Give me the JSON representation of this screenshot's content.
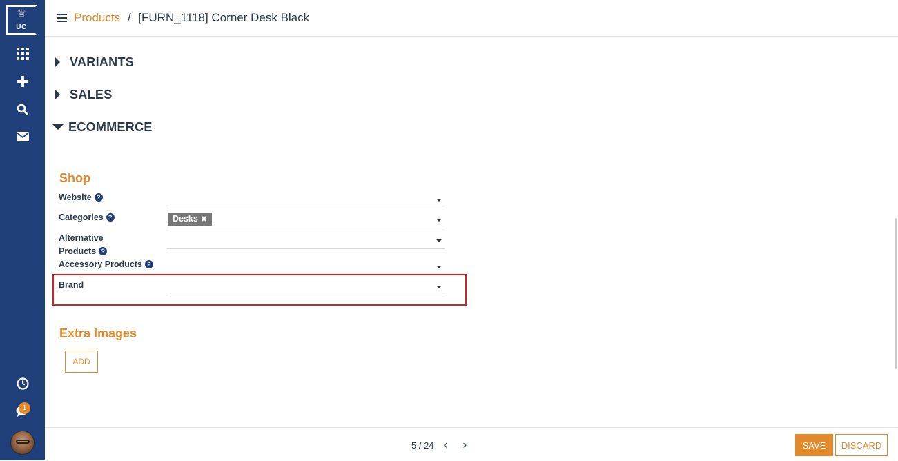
{
  "sidebar": {
    "logo_text": "UC",
    "icons": [
      "apps-grid-icon",
      "plus-icon",
      "search-icon",
      "mail-icon",
      "clock-icon",
      "chat-icon"
    ],
    "chat_badge": "1"
  },
  "breadcrumb": {
    "parent": "Products",
    "separator": "/",
    "current": "[FURN_1118] Corner Desk Black"
  },
  "sections": [
    {
      "label": "VARIANTS",
      "expanded": false
    },
    {
      "label": "SALES",
      "expanded": false
    },
    {
      "label": "ECOMMERCE",
      "expanded": true
    }
  ],
  "shop": {
    "title": "Shop",
    "website_label": "Website",
    "categories_label": "Categories",
    "categories_tag": "Desks",
    "alternative_label_line1": "Alternative",
    "alternative_label_line2": "Products",
    "accessory_label": "Accessory Products",
    "brand_label": "Brand"
  },
  "extra_images": {
    "title": "Extra Images",
    "add_label": "ADD"
  },
  "pager": {
    "text": "5 / 24"
  },
  "actions": {
    "save": "SAVE",
    "discard": "DISCARD"
  },
  "colors": {
    "sidebar": "#1f3f7a",
    "accent": "#e08a2c",
    "highlight": "#d42020"
  }
}
